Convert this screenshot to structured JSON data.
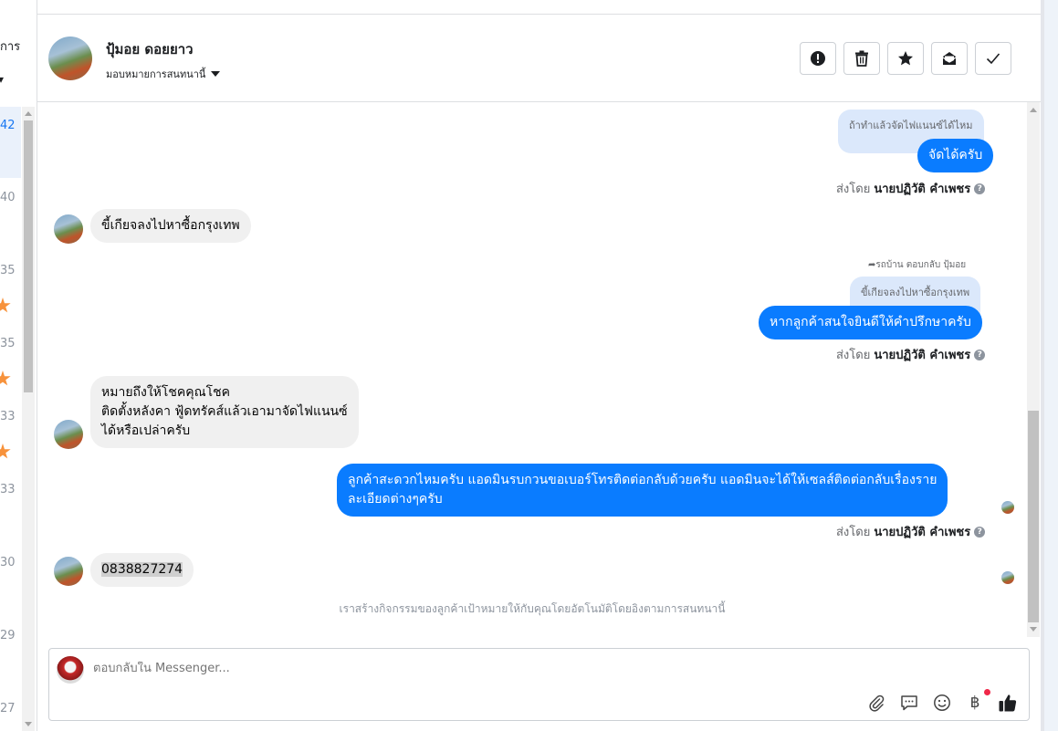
{
  "left_list": {
    "header_text": "การ",
    "timestamps": [
      "42",
      "40",
      "35",
      "35",
      "33",
      "33",
      "30",
      "29",
      "27"
    ]
  },
  "header": {
    "name": "ปุ้มอย ดอยยาว",
    "assign_label": "มอบหมายการสนทนานี้",
    "actions": [
      "spam-icon",
      "trash-icon",
      "star-icon",
      "mark-unread-icon",
      "done-icon"
    ]
  },
  "messages": {
    "quote1": "ถ้าทำแล้วจัดไฟแนนซ์ได้ไหม",
    "out1": "จัดได้ครับ",
    "sent_by_prefix": "ส่งโดย",
    "sent_by_name": "นายปฏิวัติ คำเพชร",
    "in1": "ขี้เกียจลงไปหาซื้อกรุงเทพ",
    "reply_note": "รถบ้าน ตอบกลับ ปุ้มอย",
    "quote2": "ขี้เกียจลงไปหาซื้อกรุงเทพ",
    "out2": "หากลูกค้าสนใจยินดีให้คำปรึกษาครับ",
    "in2_line1": "หมายถึงให้โชคคุณโชค",
    "in2_line2": "ติดตั้งหลังคา ฟู้ดทรัคส์แล้วเอามาจัดไฟแนนซ์",
    "in2_line3": "ได้หรือเปล่าครับ",
    "out3_line1": "ลูกค้าสะดวกไหมครับ แอดมินรบกวนขอเบอร์โทรติดต่อกลับด้วยครับ แอดมินจะได้ให้เซลส์ติดต่อกลับเรื่องราย",
    "out3_line2": "ละเอียดต่างๆครับ",
    "in3": "0838827274",
    "system_note": "เราสร้างกิจกรรมของลูกค้าเป้าหมายให้กับคุณโดยอัตโนมัติโดยอิงตามการสนทนานี้"
  },
  "composer": {
    "placeholder": "ตอบกลับใน Messenger...",
    "tools": [
      "attachment-icon",
      "saved-reply-icon",
      "emoji-icon",
      "payment-icon",
      "like-icon"
    ],
    "currency_symbol": "฿"
  },
  "colors": {
    "outgoing_bubble": "#0a7cff",
    "incoming_bubble": "#f0f0f0",
    "quote_bubble": "#dbe8fb",
    "star": "#f7923b",
    "notification_dot": "#f02849"
  }
}
